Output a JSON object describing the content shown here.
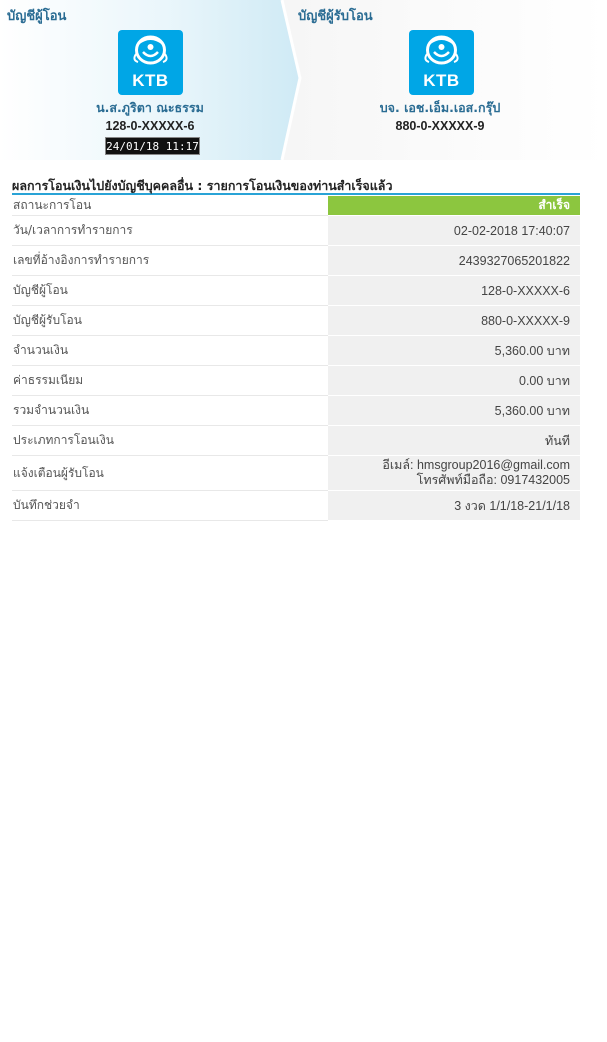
{
  "from_panel": {
    "title": "บัญชีผู้โอน",
    "bank_logo_text": "KTB",
    "account_name": "น.ส.ภูริตา ณะธรรม",
    "account_number": "128-0-XXXXX-6",
    "timestamp_box": "24/01/18 11:17"
  },
  "to_panel": {
    "title": "บัญชีผู้รับโอน",
    "bank_logo_text": "KTB",
    "account_name": "บจ. เอช.เอ็ม.เอส.กรุ๊ป",
    "account_number": "880-0-XXXXX-9"
  },
  "result": {
    "heading": "ผลการโอนเงินไปยังบัญชีบุคคลอื่น : รายการโอนเงินของท่านสำเร็จแล้ว",
    "rows": [
      {
        "label": "สถานะการโอน",
        "value": "สำเร็จ"
      },
      {
        "label": "วัน/เวลาการทำรายการ",
        "value": "02-02-2018 17:40:07"
      },
      {
        "label": "เลขที่อ้างอิงการทำรายการ",
        "value": "2439327065201822"
      },
      {
        "label": "บัญชีผู้โอน",
        "value": "128-0-XXXXX-6"
      },
      {
        "label": "บัญชีผู้รับโอน",
        "value": "880-0-XXXXX-9"
      },
      {
        "label": "จำนวนเงิน",
        "value": "5,360.00 บาท"
      },
      {
        "label": "ค่าธรรมเนียม",
        "value": "0.00 บาท"
      },
      {
        "label": "รวมจำนวนเงิน",
        "value": "5,360.00 บาท"
      },
      {
        "label": "ประเภทการโอนเงิน",
        "value": "ทันที"
      },
      {
        "label": "แจ้งเตือนผู้รับโอน",
        "value_line1": "อีเมล์: hmsgroup2016@gmail.com",
        "value_line2": "โทรศัพท์มือถือ: 0917432005"
      },
      {
        "label": "บันทึกช่วยจำ",
        "value": "3 งวด 1/1/18-21/1/18"
      }
    ]
  },
  "colors": {
    "title_blue": "#2a6c93",
    "ktb_blue": "#00a6e6",
    "success_green": "#8cc63f",
    "header_rule": "#29a3d6"
  },
  "icons": {
    "from_logo": "ktb-garuda-logo-icon",
    "to_logo": "ktb-garuda-logo-icon"
  }
}
